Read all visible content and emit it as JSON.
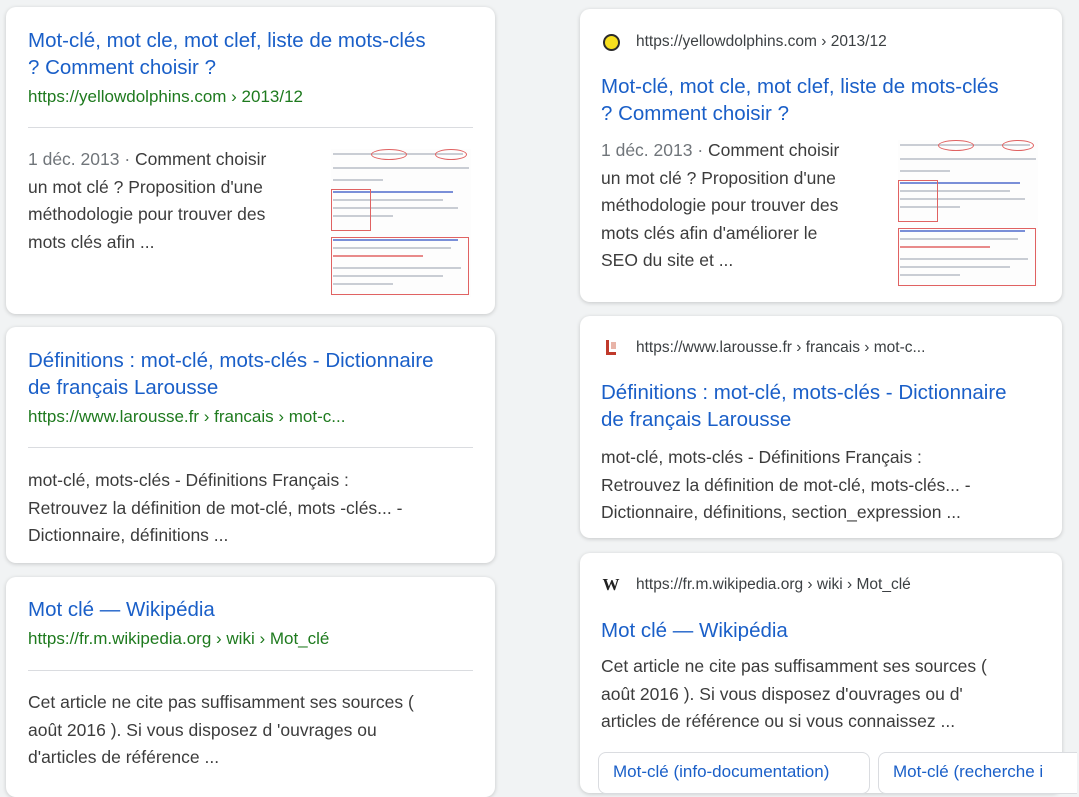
{
  "left": {
    "results": [
      {
        "title_line1": "Mot-clé, mot cle, mot clef, liste de mots-clés",
        "title_line2": "? Comment choisir ?",
        "url": "https://yellowdolphins.com › 2013/12",
        "date": "1 déc. 2013 · ",
        "snippet_lines": [
          "Comment choisir",
          "un mot clé ? Proposition d'une",
          "méthodologie pour trouver des",
          "mots clés afin ..."
        ]
      },
      {
        "title_line1": "Définitions : mot-clé, mots-clés - Dictionnaire",
        "title_line2": "de français Larousse",
        "url": "https://www.larousse.fr › francais › mot-c...",
        "snippet_lines": [
          "mot-clé, mots-clés - Définitions Français :",
          "Retrouvez la définition de mot-clé, mots -clés... -",
          "Dictionnaire, définitions ..."
        ]
      },
      {
        "title_line1": "Mot clé — Wikipédia",
        "url": "https://fr.m.wikipedia.org › wiki › Mot_clé",
        "snippet_lines": [
          "Cet article ne cite pas suffisamment ses sources (",
          "août 2016 ). Si vous disposez d 'ouvrages ou",
          "d'articles de référence ..."
        ]
      }
    ]
  },
  "right": {
    "results": [
      {
        "site_url": "https://yellowdolphins.com › 2013/12",
        "favicon": "yellow-circle-icon",
        "title_line1": "Mot-clé, mot cle, mot clef, liste de mots-clés",
        "title_line2": "? Comment choisir ?",
        "date": "1 déc. 2013 · ",
        "snippet_lines": [
          "Comment choisir",
          "un mot clé ? Proposition d'une",
          "méthodologie pour trouver des",
          "mots clés afin d'améliorer le",
          "SEO du site et ..."
        ]
      },
      {
        "site_url": "https://www.larousse.fr › francais › mot-c...",
        "favicon": "larousse-icon",
        "title_line1": "Définitions : mot-clé, mots-clés - Dictionnaire",
        "title_line2": "de français Larousse",
        "snippet_lines": [
          "mot-clé, mots-clés - Définitions Français :",
          "Retrouvez la définition de mot-clé, mots-clés... -",
          "Dictionnaire, définitions, section_expression ..."
        ]
      },
      {
        "site_url": "https://fr.m.wikipedia.org › wiki › Mot_clé",
        "favicon": "wikipedia-icon",
        "favicon_glyph": "W",
        "title_line1": "Mot clé — Wikipédia",
        "snippet_lines": [
          "Cet article ne cite pas suffisamment ses sources (",
          "août 2016 ). Si vous disposez d'ouvrages ou d'",
          "articles de référence ou si vous connaissez ..."
        ],
        "chips": [
          "Mot-clé (info-documentation)",
          "Mot-clé (recherche i"
        ]
      }
    ]
  },
  "colors": {
    "title": "#1a5fc8",
    "url_green": "#1e7a1e",
    "background": "#f1f3f4"
  }
}
